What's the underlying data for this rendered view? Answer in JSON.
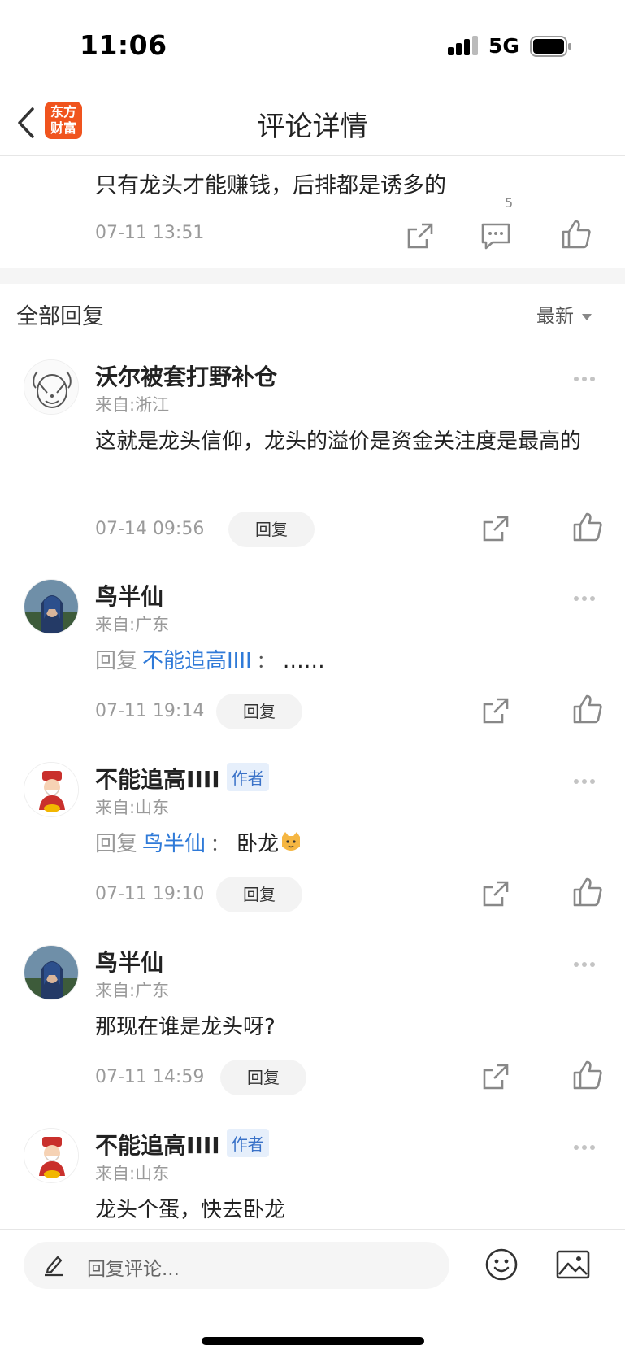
{
  "status_bar": {
    "time": "11:06",
    "network": "5G"
  },
  "nav": {
    "title": "评论详情",
    "logo_line1": "东方",
    "logo_line2": "财富"
  },
  "top_comment": {
    "text": "只有龙头才能赚钱，后排都是诱多的",
    "time": "07-11 13:51",
    "reply_count": "5"
  },
  "section": {
    "title": "全部回复",
    "sort_label": "最新"
  },
  "reply_button_label": "回复",
  "author_label": "作者",
  "replies": [
    {
      "user": "沃尔被套打野补仓",
      "location": "来自:浙江",
      "text": "这就是龙头信仰，龙头的溢价是资金关注度是最高的",
      "time": "07-14 09:56",
      "avatar": "cartoon-face-icon"
    },
    {
      "user": "鸟半仙",
      "location": "来自:广东",
      "reply_prefix": "回复",
      "mention": "不能追高IIII",
      "colon": "：",
      "text": "……",
      "time": "07-11 19:14",
      "avatar": "warrior-portrait"
    },
    {
      "user": "不能追高IIII",
      "location": "来自:山东",
      "reply_prefix": "回复",
      "mention": "鸟半仙",
      "colon": "：",
      "text": "卧龙",
      "time": "07-11 19:10",
      "avatar": "god-of-wealth-icon",
      "emoji": "cat-emoji"
    },
    {
      "user": "鸟半仙",
      "location": "来自:广东",
      "text": "那现在谁是龙头呀?",
      "time": "07-11 14:59",
      "avatar": "warrior-portrait"
    },
    {
      "user": "不能追高IIII",
      "location": "来自:山东",
      "text": "龙头个蛋，快去卧龙",
      "avatar": "god-of-wealth-icon"
    }
  ],
  "bottom_bar": {
    "placeholder": "回复评论..."
  },
  "colors": {
    "accent_blue": "#2f7ad8",
    "brand_orange": "#f0541e",
    "meta_gray": "#9a9a9a"
  }
}
